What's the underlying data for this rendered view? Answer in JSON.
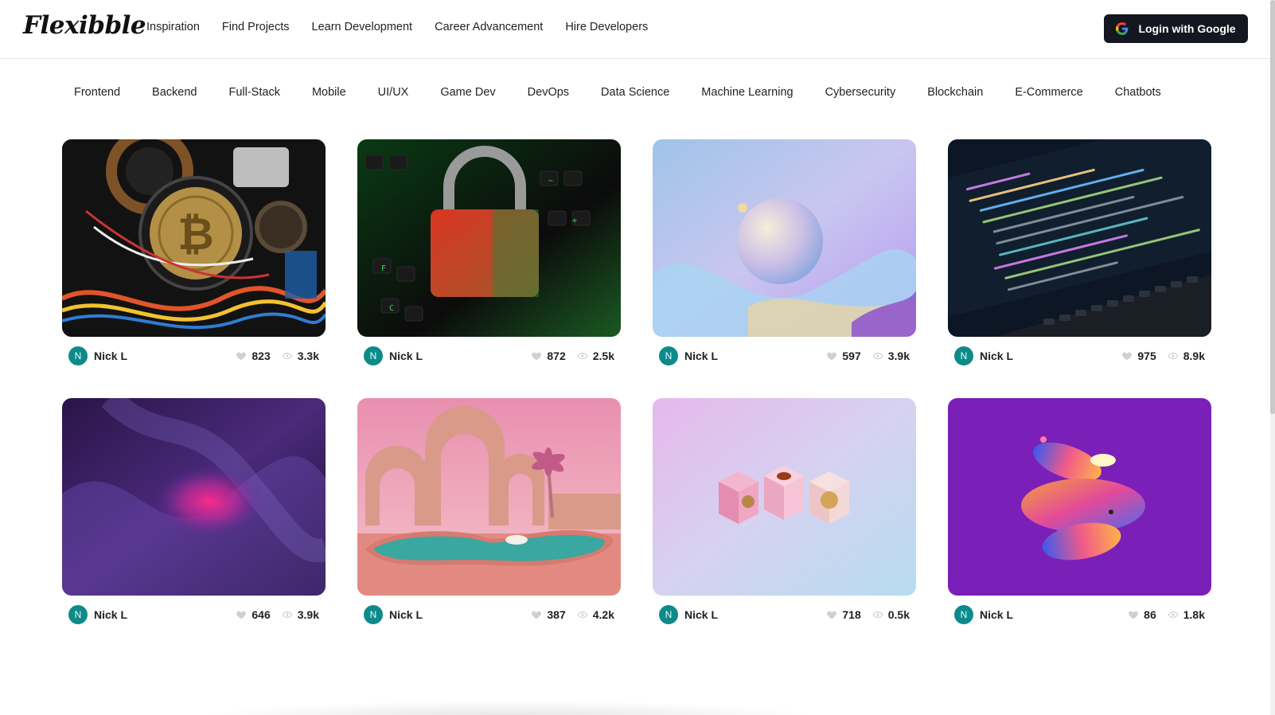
{
  "brand": {
    "logo_text": "Flexibble"
  },
  "nav": {
    "links": [
      "Inspiration",
      "Find Projects",
      "Learn Development",
      "Career Advancement",
      "Hire Developers"
    ],
    "login_label": "Login with Google"
  },
  "categories": [
    "Frontend",
    "Backend",
    "Full-Stack",
    "Mobile",
    "UI/UX",
    "Game Dev",
    "DevOps",
    "Data Science",
    "Machine Learning",
    "Cybersecurity",
    "Blockchain",
    "E-Commerce",
    "Chatbots"
  ],
  "projects": [
    {
      "author": "Nick L",
      "avatar_initial": "N",
      "likes": "823",
      "views": "3.3k",
      "thumb": "bitcoin-electronics"
    },
    {
      "author": "Nick L",
      "avatar_initial": "N",
      "likes": "872",
      "views": "2.5k",
      "thumb": "padlock-keyboard"
    },
    {
      "author": "Nick L",
      "avatar_initial": "N",
      "likes": "597",
      "views": "3.9k",
      "thumb": "pastel-sphere"
    },
    {
      "author": "Nick L",
      "avatar_initial": "N",
      "likes": "975",
      "views": "8.9k",
      "thumb": "code-screen"
    },
    {
      "author": "Nick L",
      "avatar_initial": "N",
      "likes": "646",
      "views": "3.9k",
      "thumb": "purple-abstract"
    },
    {
      "author": "Nick L",
      "avatar_initial": "N",
      "likes": "387",
      "views": "4.2k",
      "thumb": "pink-pool"
    },
    {
      "author": "Nick L",
      "avatar_initial": "N",
      "likes": "718",
      "views": "0.5k",
      "thumb": "pink-cubes"
    },
    {
      "author": "Nick L",
      "avatar_initial": "N",
      "likes": "86",
      "views": "1.8k",
      "thumb": "gradient-shapes"
    }
  ],
  "colors": {
    "avatar": "#0e8a8a",
    "login_bg": "#14171f",
    "accent_purple": "#7a1fb8"
  },
  "icons": {
    "like": "heart-icon",
    "view": "eye-icon",
    "google": "google-icon"
  }
}
